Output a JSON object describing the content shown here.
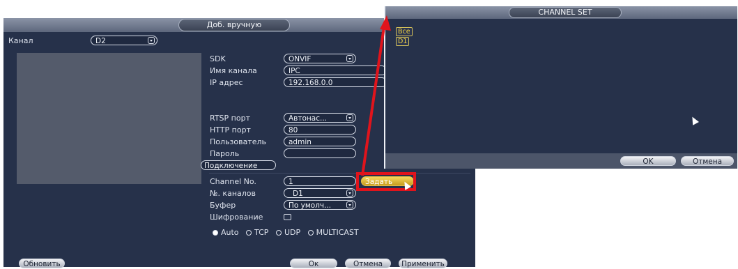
{
  "main_dialog": {
    "title": "Доб. вручную",
    "channel_label": "Канал",
    "channel_value": "D2",
    "fields": {
      "sdk_label": "SDK",
      "sdk_value": "ONVIF",
      "name_label": "Имя канала",
      "name_value": "IPC",
      "ip_label": "IP адрес",
      "ip_value": "192.168.0.0",
      "rtsp_label": "RTSP порт",
      "rtsp_value": "Автонас...",
      "http_label": "HTTP порт",
      "http_value": "80",
      "user_label": "Пользователь",
      "user_value": "admin",
      "password_label": "Пароль",
      "password_value": "",
      "connect_button": "Подключение",
      "channel_no_label": "Channel No.",
      "channel_no_value": "1",
      "set_button": "Задать",
      "channels_label": "№. каналов",
      "channels_value": "D1",
      "buffer_label": "Буфер",
      "buffer_value": "По умолч...",
      "encryption_label": "Шифрование"
    },
    "protocols": [
      "Auto",
      "TCP",
      "UDP",
      "MULTICAST"
    ],
    "selected_protocol": "Auto",
    "footer": {
      "refresh_button": "Обновить",
      "ok_button": "Ок",
      "cancel_button": "Отмена",
      "apply_button": "Применить"
    }
  },
  "channel_set_dialog": {
    "title": "CHANNEL SET",
    "tags": [
      "Все",
      "D1"
    ],
    "ok_button": "OK",
    "cancel_button": "Отмена"
  },
  "colors": {
    "panel_bg": "#26314a",
    "titlebar": "#7a8396",
    "tag_yellow": "#f5d640",
    "annotation_red": "#e0141c"
  }
}
